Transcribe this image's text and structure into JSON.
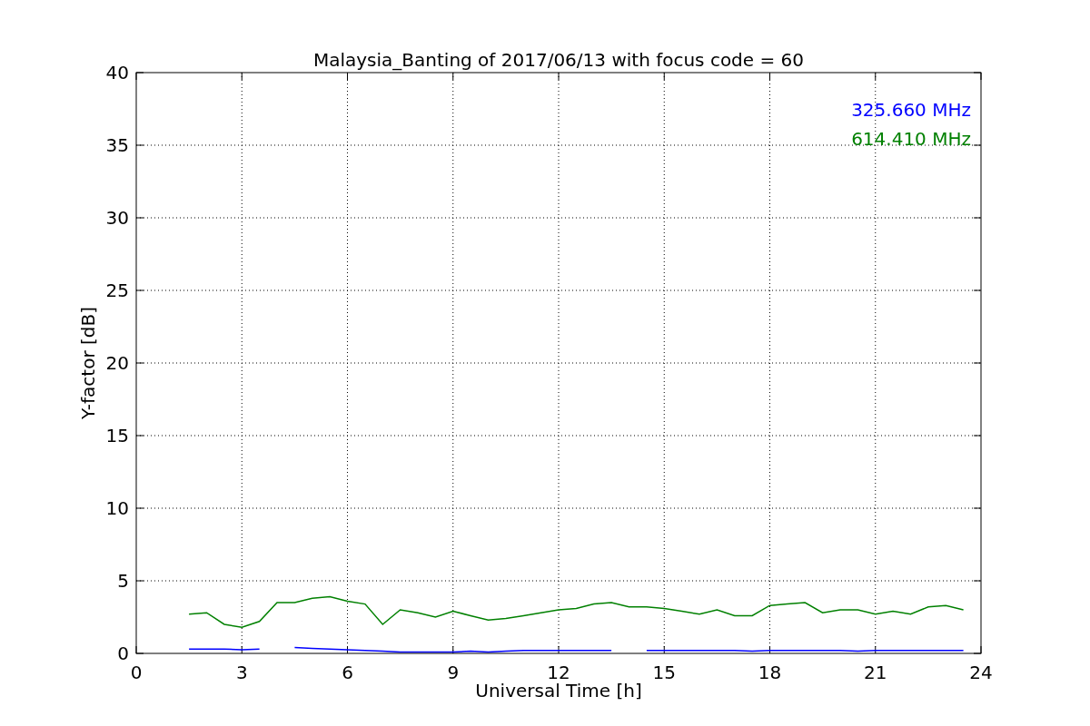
{
  "chart_data": {
    "type": "line",
    "title": "Malaysia_Banting of 2017/06/13 with focus code = 60",
    "xlabel": "Universal Time [h]",
    "ylabel": "Y-factor [dB]",
    "x": [
      1.5,
      2,
      2.5,
      3,
      3.5,
      4,
      4.5,
      5,
      5.5,
      6,
      6.5,
      7,
      7.5,
      8,
      8.5,
      9,
      9.5,
      10,
      10.5,
      11,
      11.5,
      12,
      12.5,
      13,
      13.5,
      14,
      14.5,
      15,
      15.5,
      16,
      16.5,
      17,
      17.5,
      18,
      18.5,
      19,
      19.5,
      20,
      20.5,
      21,
      21.5,
      22,
      22.5,
      23,
      23.5
    ],
    "series": [
      {
        "name": "325.660 MHz",
        "color": "#0000ff",
        "values": [
          0.3,
          0.3,
          0.3,
          0.25,
          0.3,
          null,
          0.4,
          0.35,
          0.3,
          0.25,
          0.2,
          0.15,
          0.1,
          0.1,
          0.1,
          0.1,
          0.15,
          0.1,
          0.15,
          0.2,
          0.2,
          0.2,
          0.2,
          0.2,
          0.2,
          null,
          0.2,
          0.2,
          0.2,
          0.2,
          0.2,
          0.2,
          0.15,
          0.2,
          0.2,
          0.2,
          0.2,
          0.2,
          0.15,
          0.2,
          0.2,
          0.2,
          0.2,
          0.2,
          0.2
        ]
      },
      {
        "name": "614.410 MHz",
        "color": "#008000",
        "values": [
          2.7,
          2.8,
          2.0,
          1.8,
          2.2,
          3.5,
          3.5,
          3.8,
          3.9,
          3.6,
          3.4,
          2.0,
          3.0,
          2.8,
          2.5,
          2.9,
          2.6,
          2.3,
          2.4,
          2.6,
          2.8,
          3.0,
          3.1,
          3.4,
          3.5,
          3.2,
          3.2,
          3.1,
          2.9,
          2.7,
          3.0,
          2.6,
          2.6,
          3.3,
          3.4,
          3.5,
          2.8,
          3.0,
          3.0,
          2.7,
          2.9,
          2.7,
          3.2,
          3.3,
          3.0
        ]
      }
    ],
    "xlim": [
      0,
      24
    ],
    "ylim": [
      0,
      40
    ],
    "xticks": [
      0,
      3,
      6,
      9,
      12,
      15,
      18,
      21,
      24
    ],
    "yticks": [
      0,
      5,
      10,
      15,
      20,
      25,
      30,
      35,
      40
    ],
    "grid": true
  }
}
